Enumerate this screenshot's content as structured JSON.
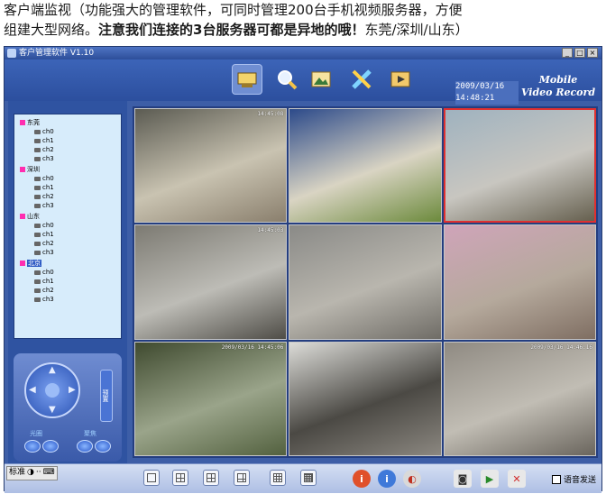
{
  "caption": {
    "line1": "客户端监视（功能强大的管理软件，可同时管理200台手机视频服务器，方便",
    "line2_a": "组建大型网络。",
    "line2_bold": "注意我们连接的3台服务器可都是异地的哦！",
    "line2_b": "东莞/深圳/山东）"
  },
  "window": {
    "title": "客户管理软件 V1.10",
    "buttons": [
      "_",
      "□",
      "×"
    ]
  },
  "toolbar": {
    "icons": [
      "monitor-icon",
      "search-icon",
      "picture-icon",
      "settings-tools-icon",
      "playback-icon"
    ],
    "clock_date": "2009/03/16",
    "clock_time": "14:48:21",
    "brand_line1": "Mobile",
    "brand_line2": "Video Record"
  },
  "tree": {
    "groups": [
      {
        "name": "东莞",
        "channels": [
          "ch0",
          "ch1",
          "ch2",
          "ch3"
        ],
        "selected": false
      },
      {
        "name": "深圳",
        "channels": [
          "ch0",
          "ch1",
          "ch2",
          "ch3"
        ],
        "selected": false
      },
      {
        "name": "山东",
        "channels": [
          "ch0",
          "ch1",
          "ch2",
          "ch3"
        ],
        "selected": false
      },
      {
        "name": "北京",
        "channels": [
          "ch0",
          "ch1",
          "ch2",
          "ch3"
        ],
        "selected": true
      }
    ]
  },
  "ptz": {
    "side_label": "预置",
    "iris_label": "光圈",
    "focus_label": "聚焦"
  },
  "cells": [
    {
      "ts": "14:45:08",
      "colors": [
        "#5b5b52",
        "#c9c3b1",
        "#8a7f6d"
      ]
    },
    {
      "ts": "",
      "colors": [
        "#2c4a8a",
        "#d9d4c3",
        "#6c8a3c"
      ]
    },
    {
      "ts": "",
      "colors": [
        "#9fb2bf",
        "#c8c6c0",
        "#66604f"
      ]
    },
    {
      "ts": "14:45:03",
      "colors": [
        "#7c7a72",
        "#bdbcb6",
        "#4f4d47"
      ]
    },
    {
      "ts": "",
      "colors": [
        "#8a8a87",
        "#b9b6ae",
        "#6f6c66"
      ]
    },
    {
      "ts": "",
      "colors": [
        "#cfa4b9",
        "#b5a99c",
        "#7f6e62"
      ]
    },
    {
      "ts": "2009/03/16 14:45:06",
      "colors": [
        "#3f4a2f",
        "#9aa48a",
        "#53613f"
      ]
    },
    {
      "ts": "",
      "colors": [
        "#dcdcd8",
        "#4b4944",
        "#8b8780"
      ]
    },
    {
      "ts": "2009/03/16 14:46:16",
      "colors": [
        "#8f8a82",
        "#c1bdb4",
        "#6a655d"
      ]
    }
  ],
  "bottombar": {
    "lang_label": "标准",
    "layout_buttons": [
      "layout-1-icon",
      "layout-4-icon",
      "layout-6-icon",
      "layout-8-icon",
      "layout-9-icon",
      "layout-16-icon"
    ],
    "action_buttons": [
      "info-red-icon",
      "info-blue-icon",
      "audio-icon",
      "camera-snapshot-icon",
      "record-icon",
      "stop-record-icon"
    ],
    "voice_label": "语音发送"
  },
  "colors": {
    "window_bg": "#3d5ea7",
    "tree_bg": "#d7ecfb",
    "group_marker": "#ff2eb0",
    "selected_cell_border": "#e03030"
  }
}
